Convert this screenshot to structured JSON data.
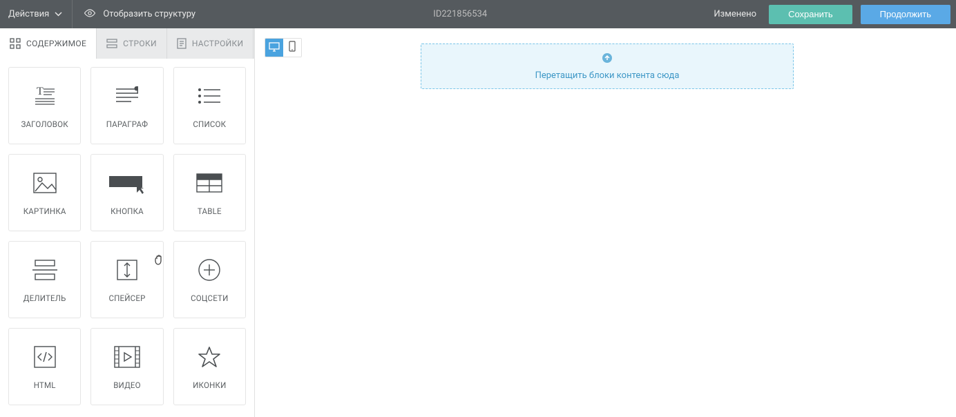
{
  "topbar": {
    "actions_label": "Действия",
    "show_structure_label": "Отобразить структуру",
    "document_id": "ID221856534",
    "modified_label": "Изменено",
    "save_label": "Сохранить",
    "continue_label": "Продолжить"
  },
  "tabs": {
    "content": "СОДЕРЖИМОЕ",
    "rows": "СТРОКИ",
    "settings": "НАСТРОЙКИ"
  },
  "blocks": [
    {
      "id": "heading",
      "label": "ЗАГОЛОВОК"
    },
    {
      "id": "paragraph",
      "label": "ПАРАГРАФ"
    },
    {
      "id": "list",
      "label": "СПИСОК"
    },
    {
      "id": "image",
      "label": "КАРТИНКА"
    },
    {
      "id": "button",
      "label": "КНОПКА"
    },
    {
      "id": "table",
      "label": "TABLE"
    },
    {
      "id": "divider",
      "label": "ДЕЛИТЕЛЬ"
    },
    {
      "id": "spacer",
      "label": "СПЕЙСЕР"
    },
    {
      "id": "social",
      "label": "СОЦСЕТИ"
    },
    {
      "id": "html",
      "label": "HTML"
    },
    {
      "id": "video",
      "label": "ВИДЕО"
    },
    {
      "id": "icons",
      "label": "ИКОНКИ"
    }
  ],
  "canvas": {
    "drop_hint": "Перетащить блоки контента сюда"
  }
}
